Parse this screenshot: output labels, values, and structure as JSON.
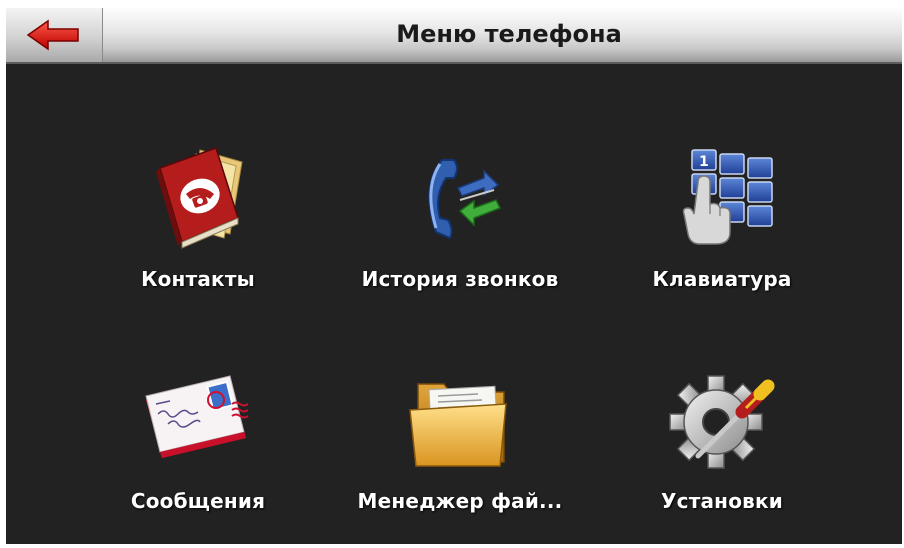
{
  "header": {
    "title": "Меню телефона",
    "back_icon": "left-arrow-icon",
    "accent": "#e01010"
  },
  "menu": [
    {
      "id": "contacts",
      "label": "Контакты",
      "icon": "address-book-icon"
    },
    {
      "id": "call-history",
      "label": "История звонков",
      "icon": "call-history-icon"
    },
    {
      "id": "keypad",
      "label": "Клавиатура",
      "icon": "keypad-icon"
    },
    {
      "id": "messages",
      "label": "Сообщения",
      "icon": "envelope-icon"
    },
    {
      "id": "file-manager",
      "label": "Менеджер фай...",
      "icon": "folder-icon"
    },
    {
      "id": "settings",
      "label": "Установки",
      "icon": "gear-screwdriver-icon"
    }
  ]
}
